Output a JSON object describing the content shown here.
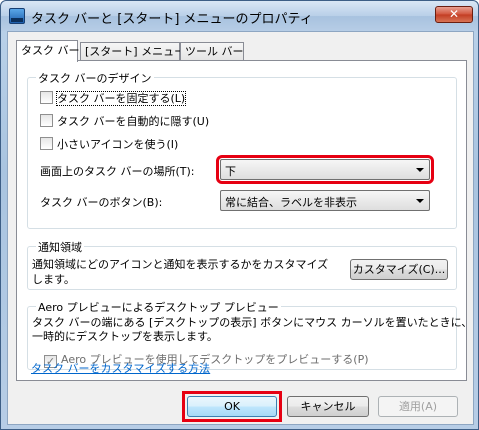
{
  "window": {
    "title": "タスク バーと [スタート] メニューのプロパティ",
    "close_glyph": "✕"
  },
  "tabs": [
    {
      "label": "タスク バー",
      "active": true
    },
    {
      "label": "[スタート] メニュー",
      "active": false
    },
    {
      "label": "ツール バー",
      "active": false
    }
  ],
  "design_group": {
    "label": "タスク バーのデザイン",
    "checkboxes": [
      {
        "label": "タスク バーを固定する(L)",
        "checked": false
      },
      {
        "label": "タスク バーを自動的に隠す(U)",
        "checked": false
      },
      {
        "label": "小さいアイコンを使う(I)",
        "checked": false
      }
    ],
    "location_label": "画面上のタスク バーの場所(T):",
    "location_value": "下",
    "buttons_label": "タスク バーのボタン(B):",
    "buttons_value": "常に結合、ラベルを非表示"
  },
  "notify_group": {
    "label": "通知領域",
    "description": "通知領域にどのアイコンと通知を表示するかをカスタマイズします。",
    "customize_button": "カスタマイズ(C)..."
  },
  "aero_group": {
    "label": "Aero プレビューによるデスクトップ プレビュー",
    "description_line1": "タスク バーの端にある [デスクトップの表示] ボタンにマウス カーソルを置いたときに、",
    "description_line2": "一時的にデスクトップを表示します。",
    "checkbox_label": "Aero プレビューを使用してデスクトップをプレビューする(P)",
    "checkbox_checked": true
  },
  "help_link": "タスク バーをカスタマイズする方法",
  "footer": {
    "ok": "OK",
    "cancel": "キャンセル",
    "apply": "適用(A)"
  },
  "colors": {
    "highlight": "#e60012",
    "link": "#0066cc"
  }
}
